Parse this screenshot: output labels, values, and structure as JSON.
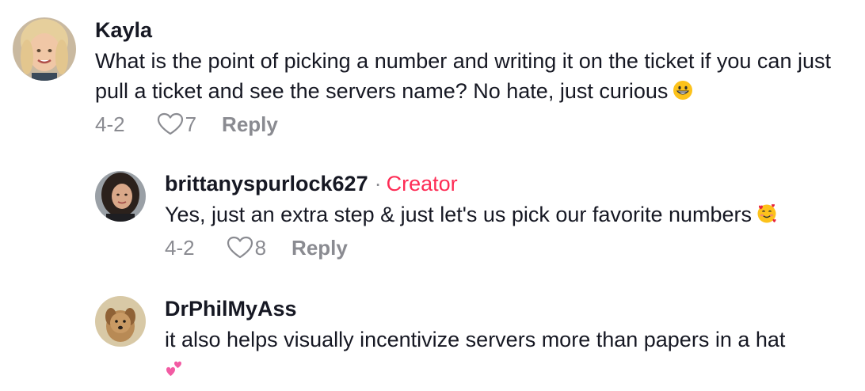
{
  "comments": [
    {
      "username": "Kayla",
      "text": "What is the point of picking a number and writing it on the ticket if you can just pull a ticket and see the servers name? No hate, just curious",
      "emoji": "grinning-face",
      "date": "4-2",
      "likes": "7",
      "reply_label": "Reply"
    },
    {
      "username": "brittanyspurlock627",
      "badge_separator": "·",
      "badge": "Creator",
      "text": "Yes, just an extra step & just let's us pick our favorite numbers",
      "emoji": "smiling-face-with-hearts",
      "date": "4-2",
      "likes": "8",
      "reply_label": "Reply"
    },
    {
      "username": "DrPhilMyAss",
      "text": "it also helps visually incentivize servers more than papers in a hat",
      "emoji": "two-hearts"
    }
  ],
  "colors": {
    "accent": "#fe2c55",
    "muted": "#8a8b91",
    "text": "#161823"
  }
}
